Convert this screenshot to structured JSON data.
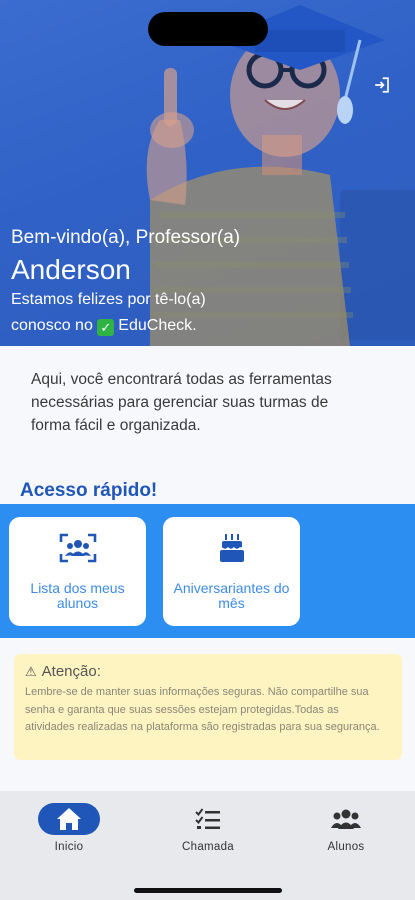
{
  "hero": {
    "greeting": "Bem-vindo(a), Professor(a)",
    "name": "Anderson",
    "subtitle_before": "Estamos felizes por tê-lo(a) conosco no",
    "check_emoji": "✓",
    "brand": "EduCheck."
  },
  "intro": {
    "text": "Aqui, você encontrará todas as ferramentas necessárias para gerenciar suas turmas de forma fácil e organizada."
  },
  "quick_access": {
    "title": "Acesso rápido!",
    "cards": [
      {
        "label": "Lista dos meus alunos",
        "icon": "students-list-icon"
      },
      {
        "label": "Aniversariantes do mês",
        "icon": "birthday-cake-icon"
      }
    ]
  },
  "alert": {
    "icon": "warning-icon",
    "warning_glyph": "⚠",
    "title": "Atenção:",
    "body": "Lembre-se de manter suas informações seguras. Não compartilhe sua senha e garanta que suas sessões estejam protegidas.Todas as atividades realizadas na plataforma são registradas para sua segurança."
  },
  "nav": {
    "items": [
      {
        "label": "Inicio",
        "icon": "home-icon",
        "active": true
      },
      {
        "label": "Chamada",
        "icon": "checklist-icon",
        "active": false
      },
      {
        "label": "Alunos",
        "icon": "group-icon",
        "active": false
      }
    ]
  },
  "colors": {
    "hero_blue": "#2f5fc4",
    "quick_blue": "#2c8ef0",
    "title_blue": "#1f56b8",
    "alert_bg": "#fdf4c2",
    "nav_bg": "#e7e9ec"
  }
}
